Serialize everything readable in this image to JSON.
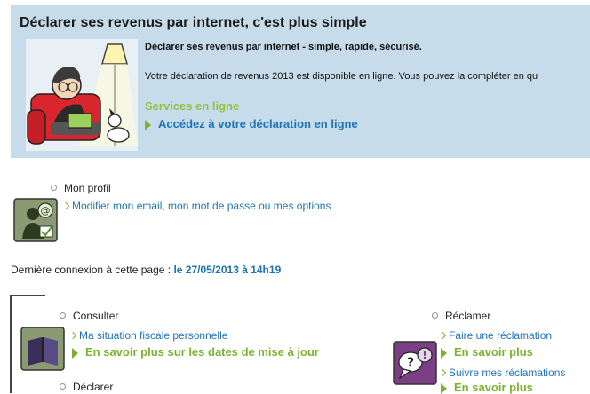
{
  "banner": {
    "title": "Déclarer ses revenus par internet, c'est plus simple",
    "subtitle": "Déclarer ses revenus par internet - simple, rapide, sécurisé.",
    "description": "Votre déclaration de revenus 2013 est disponible en ligne. Vous pouvez la compléter en qu",
    "services_title": "Services en ligne",
    "services_link": "Accédez à votre déclaration en ligne"
  },
  "profile": {
    "heading": "Mon profil",
    "link": "Modifier mon email, mon mot de passe ou mes options"
  },
  "last_connection": {
    "label": "Dernière connexion à cette page :",
    "value": "le 27/05/2013 à 14h19"
  },
  "consulter": {
    "heading": "Consulter",
    "link": "Ma situation fiscale personnelle",
    "more": "En savoir plus sur les dates de mise à jour"
  },
  "declarer": {
    "heading": "Déclarer"
  },
  "reclamer": {
    "heading": "Réclamer",
    "link1": "Faire une réclamation",
    "more1": "En savoir plus",
    "link2": "Suivre mes réclamations",
    "more2": "En savoir plus"
  },
  "colors": {
    "banner_bg": "#c6dcea",
    "link_blue": "#1e73b7",
    "accent_green": "#7ab32e",
    "icon_profile_bg": "#8a9a72",
    "icon_reclamer_bg": "#7a3f85"
  }
}
